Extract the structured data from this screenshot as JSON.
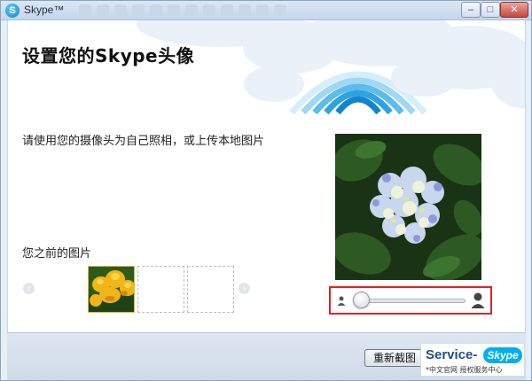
{
  "window": {
    "title": "Skype™",
    "controls": {
      "minimize": "–",
      "maximize": "□",
      "close": "✕"
    }
  },
  "colors": {
    "skype_blue": "#00aff0",
    "highlight_red": "#e02323",
    "cloud_blue": "#2ea3e2"
  },
  "main": {
    "heading": "设置您的Skype头像",
    "instruction": "请使用您的摄像头为自己照相，或上传本地图片",
    "previous_label": "您之前的图片"
  },
  "icons": {
    "prev_arrow": "‹",
    "next_arrow": "›"
  },
  "buttons": {
    "retake": "重新截图"
  },
  "watermark": {
    "text": "Service-",
    "brand": "Skype",
    "subtext": "*中文官网 授权服务中心"
  }
}
